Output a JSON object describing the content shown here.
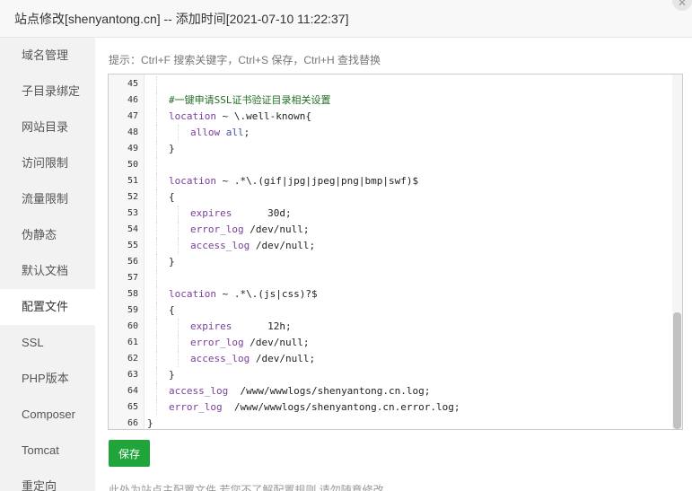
{
  "window": {
    "title": "站点修改[shenyantong.cn] -- 添加时间[2021-07-10 11:22:37]",
    "close_glyph": "✕"
  },
  "sidebar": {
    "items": [
      {
        "label": "域名管理"
      },
      {
        "label": "子目录绑定"
      },
      {
        "label": "网站目录"
      },
      {
        "label": "访问限制"
      },
      {
        "label": "流量限制"
      },
      {
        "label": "伪静态"
      },
      {
        "label": "默认文档"
      },
      {
        "label": "配置文件",
        "active": true
      },
      {
        "label": "SSL"
      },
      {
        "label": "PHP版本"
      },
      {
        "label": "Composer"
      },
      {
        "label": "Tomcat"
      },
      {
        "label": "重定向"
      }
    ]
  },
  "main": {
    "hint": "提示：Ctrl+F 搜索关键字，Ctrl+S 保存，Ctrl+H 查找替换",
    "save_label": "保存",
    "footnote": "此处为站点主配置文件,若您不了解配置规则,请勿随意修改."
  },
  "editor": {
    "lines": [
      {
        "n": "45",
        "indent": 1,
        "parts": []
      },
      {
        "n": "46",
        "indent": 1,
        "parts": [
          {
            "t": "#一键申请SSL证书验证目录相关设置",
            "c": "comment"
          }
        ]
      },
      {
        "n": "47",
        "indent": 1,
        "parts": [
          {
            "t": "location",
            "c": "kw"
          },
          {
            "t": " ~ \\.well-known{",
            "c": "re"
          }
        ]
      },
      {
        "n": "48",
        "indent": 2,
        "parts": [
          {
            "t": "allow",
            "c": "kw"
          },
          {
            "t": " ",
            "c": "plain"
          },
          {
            "t": "all",
            "c": "val"
          },
          {
            "t": ";",
            "c": "plain"
          }
        ]
      },
      {
        "n": "49",
        "indent": 1,
        "parts": [
          {
            "t": "}",
            "c": "plain"
          }
        ]
      },
      {
        "n": "50",
        "indent": 1,
        "parts": []
      },
      {
        "n": "51",
        "indent": 1,
        "parts": [
          {
            "t": "location",
            "c": "kw"
          },
          {
            "t": " ~ .*\\.(gif|jpg|jpeg|png|bmp|swf)$",
            "c": "re"
          }
        ]
      },
      {
        "n": "52",
        "indent": 1,
        "parts": [
          {
            "t": "{",
            "c": "plain"
          }
        ]
      },
      {
        "n": "53",
        "indent": 2,
        "parts": [
          {
            "t": "expires",
            "c": "kw"
          },
          {
            "t": "      30d;",
            "c": "plain"
          }
        ]
      },
      {
        "n": "54",
        "indent": 2,
        "parts": [
          {
            "t": "error_log",
            "c": "kw"
          },
          {
            "t": " /dev/null;",
            "c": "plain"
          }
        ]
      },
      {
        "n": "55",
        "indent": 2,
        "parts": [
          {
            "t": "access_log",
            "c": "kw"
          },
          {
            "t": " /dev/null;",
            "c": "plain"
          }
        ]
      },
      {
        "n": "56",
        "indent": 1,
        "parts": [
          {
            "t": "}",
            "c": "plain"
          }
        ]
      },
      {
        "n": "57",
        "indent": 1,
        "parts": []
      },
      {
        "n": "58",
        "indent": 1,
        "parts": [
          {
            "t": "location",
            "c": "kw"
          },
          {
            "t": " ~ .*\\.(js|css)?$",
            "c": "re"
          }
        ]
      },
      {
        "n": "59",
        "indent": 1,
        "parts": [
          {
            "t": "{",
            "c": "plain"
          }
        ]
      },
      {
        "n": "60",
        "indent": 2,
        "parts": [
          {
            "t": "expires",
            "c": "kw"
          },
          {
            "t": "      12h;",
            "c": "plain"
          }
        ]
      },
      {
        "n": "61",
        "indent": 2,
        "parts": [
          {
            "t": "error_log",
            "c": "kw"
          },
          {
            "t": " /dev/null;",
            "c": "plain"
          }
        ]
      },
      {
        "n": "62",
        "indent": 2,
        "parts": [
          {
            "t": "access_log",
            "c": "kw"
          },
          {
            "t": " /dev/null;",
            "c": "plain"
          }
        ]
      },
      {
        "n": "63",
        "indent": 1,
        "parts": [
          {
            "t": "}",
            "c": "plain"
          }
        ]
      },
      {
        "n": "64",
        "indent": 1,
        "parts": [
          {
            "t": "access_log",
            "c": "kw"
          },
          {
            "t": "  /www/wwwlogs/shenyantong.cn.log;",
            "c": "plain"
          }
        ]
      },
      {
        "n": "65",
        "indent": 1,
        "parts": [
          {
            "t": "error_log",
            "c": "kw"
          },
          {
            "t": "  /www/wwwlogs/shenyantong.cn.error.log;",
            "c": "plain"
          }
        ]
      },
      {
        "n": "66",
        "indent": 0,
        "parts": [
          {
            "t": "}",
            "c": "plain"
          }
        ]
      }
    ]
  },
  "colors": {
    "accent": "#20a53a",
    "comment": "#236e25",
    "keyword": "#7a3e9d"
  }
}
